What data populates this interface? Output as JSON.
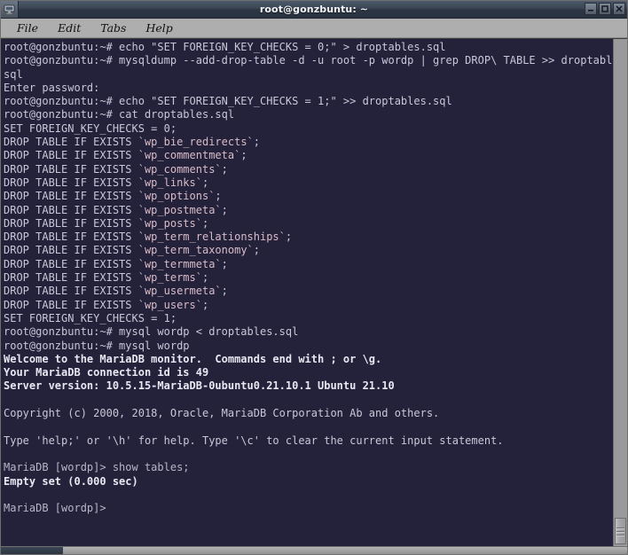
{
  "window": {
    "title": "root@gonzbuntu: ~",
    "icon": "terminal-monitor-icon",
    "controls": {
      "minimize_label": "–",
      "maximize_label": "□",
      "close_label": "✕"
    }
  },
  "menubar": {
    "items": [
      {
        "label": "File"
      },
      {
        "label": "Edit"
      },
      {
        "label": "Tabs"
      },
      {
        "label": "Help"
      }
    ]
  },
  "colors": {
    "terminal_background": "#24213a",
    "terminal_foreground": "#c8c8d8",
    "terminal_bold": "#e8e8f2",
    "table_name": "#d8bcc8",
    "titlebar_start": "#4c5a6b",
    "titlebar_end": "#283240",
    "menubar_background": "#aeaeae",
    "scrollbar_track": "#9a9a9a"
  },
  "terminal": {
    "prompt_user_host": "root@gonzbuntu:~#",
    "mysql_prompt": "MariaDB [wordp]>",
    "lines": [
      {
        "text": "root@gonzbuntu:~# echo \"SET FOREIGN_KEY_CHECKS = 0;\" > droptables.sql",
        "style": "normal"
      },
      {
        "text": "root@gonzbuntu:~# mysqldump --add-drop-table -d -u root -p wordp | grep DROP\\ TABLE >> droptables.",
        "style": "normal"
      },
      {
        "text": "sql",
        "style": "normal"
      },
      {
        "text": "Enter password:",
        "style": "normal"
      },
      {
        "text": "root@gonzbuntu:~# echo \"SET FOREIGN_KEY_CHECKS = 1;\" >> droptables.sql",
        "style": "normal"
      },
      {
        "text": "root@gonzbuntu:~# cat droptables.sql",
        "style": "normal"
      },
      {
        "text": "SET FOREIGN_KEY_CHECKS = 0;",
        "style": "normal"
      },
      {
        "text": "DROP TABLE IF EXISTS `wp_bie_redirects`;",
        "style": "table"
      },
      {
        "text": "DROP TABLE IF EXISTS `wp_commentmeta`;",
        "style": "table"
      },
      {
        "text": "DROP TABLE IF EXISTS `wp_comments`;",
        "style": "table"
      },
      {
        "text": "DROP TABLE IF EXISTS `wp_links`;",
        "style": "table"
      },
      {
        "text": "DROP TABLE IF EXISTS `wp_options`;",
        "style": "table"
      },
      {
        "text": "DROP TABLE IF EXISTS `wp_postmeta`;",
        "style": "table"
      },
      {
        "text": "DROP TABLE IF EXISTS `wp_posts`;",
        "style": "table"
      },
      {
        "text": "DROP TABLE IF EXISTS `wp_term_relationships`;",
        "style": "table"
      },
      {
        "text": "DROP TABLE IF EXISTS `wp_term_taxonomy`;",
        "style": "table"
      },
      {
        "text": "DROP TABLE IF EXISTS `wp_termmeta`;",
        "style": "table"
      },
      {
        "text": "DROP TABLE IF EXISTS `wp_terms`;",
        "style": "table"
      },
      {
        "text": "DROP TABLE IF EXISTS `wp_usermeta`;",
        "style": "table"
      },
      {
        "text": "DROP TABLE IF EXISTS `wp_users`;",
        "style": "table"
      },
      {
        "text": "SET FOREIGN_KEY_CHECKS = 1;",
        "style": "normal"
      },
      {
        "text": "root@gonzbuntu:~# mysql wordp < droptables.sql",
        "style": "normal"
      },
      {
        "text": "root@gonzbuntu:~# mysql wordp",
        "style": "normal"
      },
      {
        "text": "Welcome to the MariaDB monitor.  Commands end with ; or \\g.",
        "style": "bold"
      },
      {
        "text": "Your MariaDB connection id is 49",
        "style": "bold"
      },
      {
        "text": "Server version: 10.5.15-MariaDB-0ubuntu0.21.10.1 Ubuntu 21.10",
        "style": "bold"
      },
      {
        "text": "",
        "style": "blank"
      },
      {
        "text": "Copyright (c) 2000, 2018, Oracle, MariaDB Corporation Ab and others.",
        "style": "normal"
      },
      {
        "text": "",
        "style": "blank"
      },
      {
        "text": "Type 'help;' or '\\h' for help. Type '\\c' to clear the current input statement.",
        "style": "normal"
      },
      {
        "text": "",
        "style": "blank"
      },
      {
        "text": "MariaDB [wordp]> show tables;",
        "style": "dim"
      },
      {
        "text": "Empty set (0.000 sec)",
        "style": "bold"
      },
      {
        "text": "",
        "style": "blank"
      },
      {
        "text": "MariaDB [wordp]>",
        "style": "dim"
      }
    ]
  },
  "scrollbar": {
    "position": "bottom",
    "thumb_label": "vertical-scroll-thumb"
  }
}
